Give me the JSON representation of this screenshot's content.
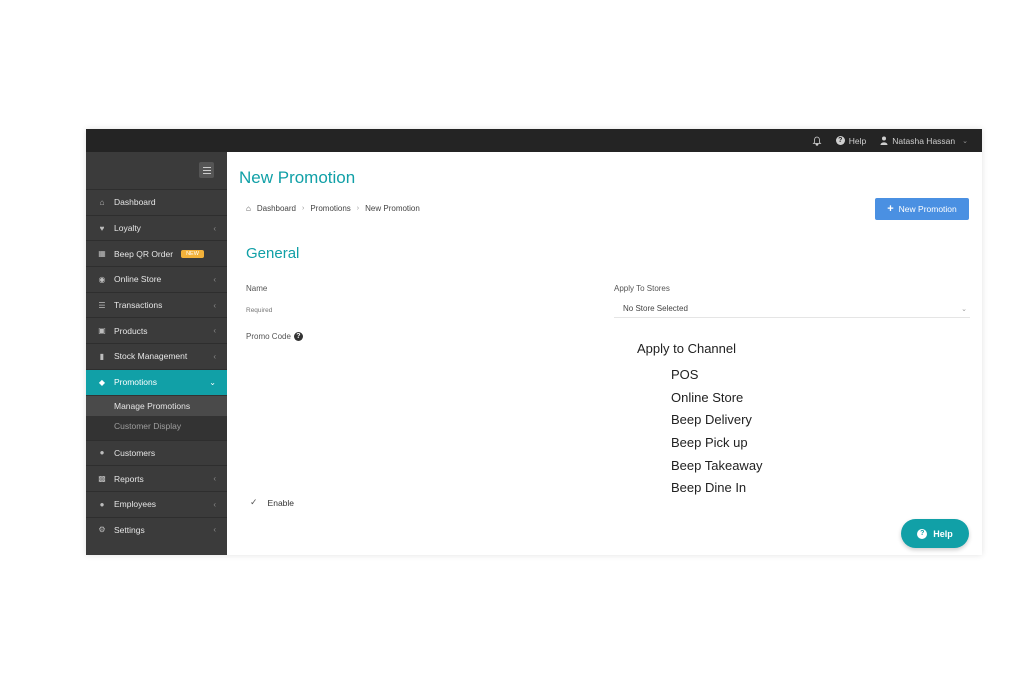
{
  "topbar": {
    "help_label": "Help",
    "user_name": "Natasha Hassan"
  },
  "sidebar": {
    "items": [
      {
        "label": "Dashboard",
        "icon": "home-icon"
      },
      {
        "label": "Loyalty",
        "icon": "heart-icon"
      },
      {
        "label": "Beep QR Order",
        "icon": "qr-icon",
        "badge": "NEW"
      },
      {
        "label": "Online Store",
        "icon": "globe-icon"
      },
      {
        "label": "Transactions",
        "icon": "list-icon"
      },
      {
        "label": "Products",
        "icon": "cart-icon"
      },
      {
        "label": "Stock Management",
        "icon": "barcode-icon"
      },
      {
        "label": "Promotions",
        "icon": "tag-icon"
      },
      {
        "label": "Customers",
        "icon": "users-icon"
      },
      {
        "label": "Reports",
        "icon": "bar-chart-icon"
      },
      {
        "label": "Employees",
        "icon": "person-icon"
      },
      {
        "label": "Settings",
        "icon": "gears-icon"
      }
    ],
    "promotions_sub": [
      {
        "label": "Manage Promotions"
      },
      {
        "label": "Customer Display"
      }
    ]
  },
  "main": {
    "page_title": "New Promotion",
    "breadcrumb": [
      "Dashboard",
      "Promotions",
      "New Promotion"
    ],
    "new_button_label": "New Promotion",
    "section_title": "General",
    "name_label": "Name",
    "name_placeholder": "Required",
    "stores_label": "Apply To Stores",
    "stores_value": "No Store Selected",
    "promo_code_label": "Promo Code",
    "channel_title": "Apply to Channel",
    "channels": [
      "POS",
      "Online Store",
      "Beep Delivery",
      "Beep Pick up",
      "Beep Takeaway",
      "Beep Dine In"
    ],
    "enable_label": "Enable",
    "help_widget_label": "Help"
  },
  "colors": {
    "accent": "#11a0a7",
    "primary_button": "#4a90e2",
    "badge": "#f3b23a",
    "topbar": "#242424",
    "sidebar": "#3b3b3b"
  }
}
